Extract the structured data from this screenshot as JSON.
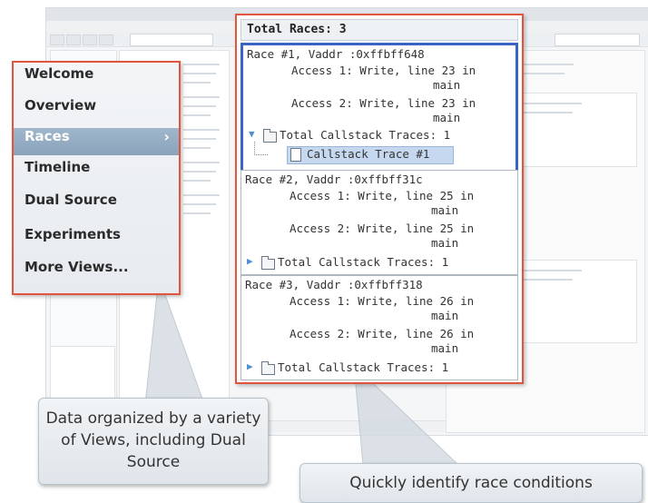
{
  "views_menu": {
    "items": [
      {
        "label": "Welcome"
      },
      {
        "label": "Overview"
      },
      {
        "label": "Races",
        "selected": true,
        "chevron": "›"
      },
      {
        "label": "Timeline"
      },
      {
        "label": "Dual Source"
      },
      {
        "label": "Experiments"
      },
      {
        "label": "More Views..."
      }
    ]
  },
  "races_panel": {
    "header": "Total Races: 3",
    "races": [
      {
        "title": "Race #1, Vaddr :0xffbff648",
        "access1": "Access 1: Write, line 23 in",
        "access1_func": "main",
        "access2": "Access 2: Write, line 23 in",
        "access2_func": "main",
        "callstack": "Total Callstack Traces: 1",
        "trace": "Callstack Trace #1",
        "expanded": true,
        "selected": true
      },
      {
        "title": "Race #2, Vaddr :0xffbff31c",
        "access1": "Access 1: Write, line 25 in",
        "access1_func": "main",
        "access2": "Access 2: Write, line 25 in",
        "access2_func": "main",
        "callstack": "Total Callstack Traces: 1",
        "expanded": false
      },
      {
        "title": "Race #3, Vaddr :0xffbff318",
        "access1": "Access 1: Write, line 26 in",
        "access1_func": "main",
        "access2": "Access 2: Write, line 26 in",
        "access2_func": "main",
        "callstack": "Total Callstack Traces: 1",
        "expanded": false
      }
    ]
  },
  "callouts": {
    "views": "Data organized by a variety of Views, including Dual Source",
    "races": "Quickly identify race conditions"
  },
  "icons": {
    "folder": "folder-icon",
    "document": "document-icon",
    "expand_toggle": "expand-toggle-icon",
    "collapse_toggle": "collapse-toggle-icon"
  },
  "colors": {
    "highlight_border": "#e1553f",
    "selection_border": "#3b63c4",
    "menu_selected": "#95adc4"
  }
}
